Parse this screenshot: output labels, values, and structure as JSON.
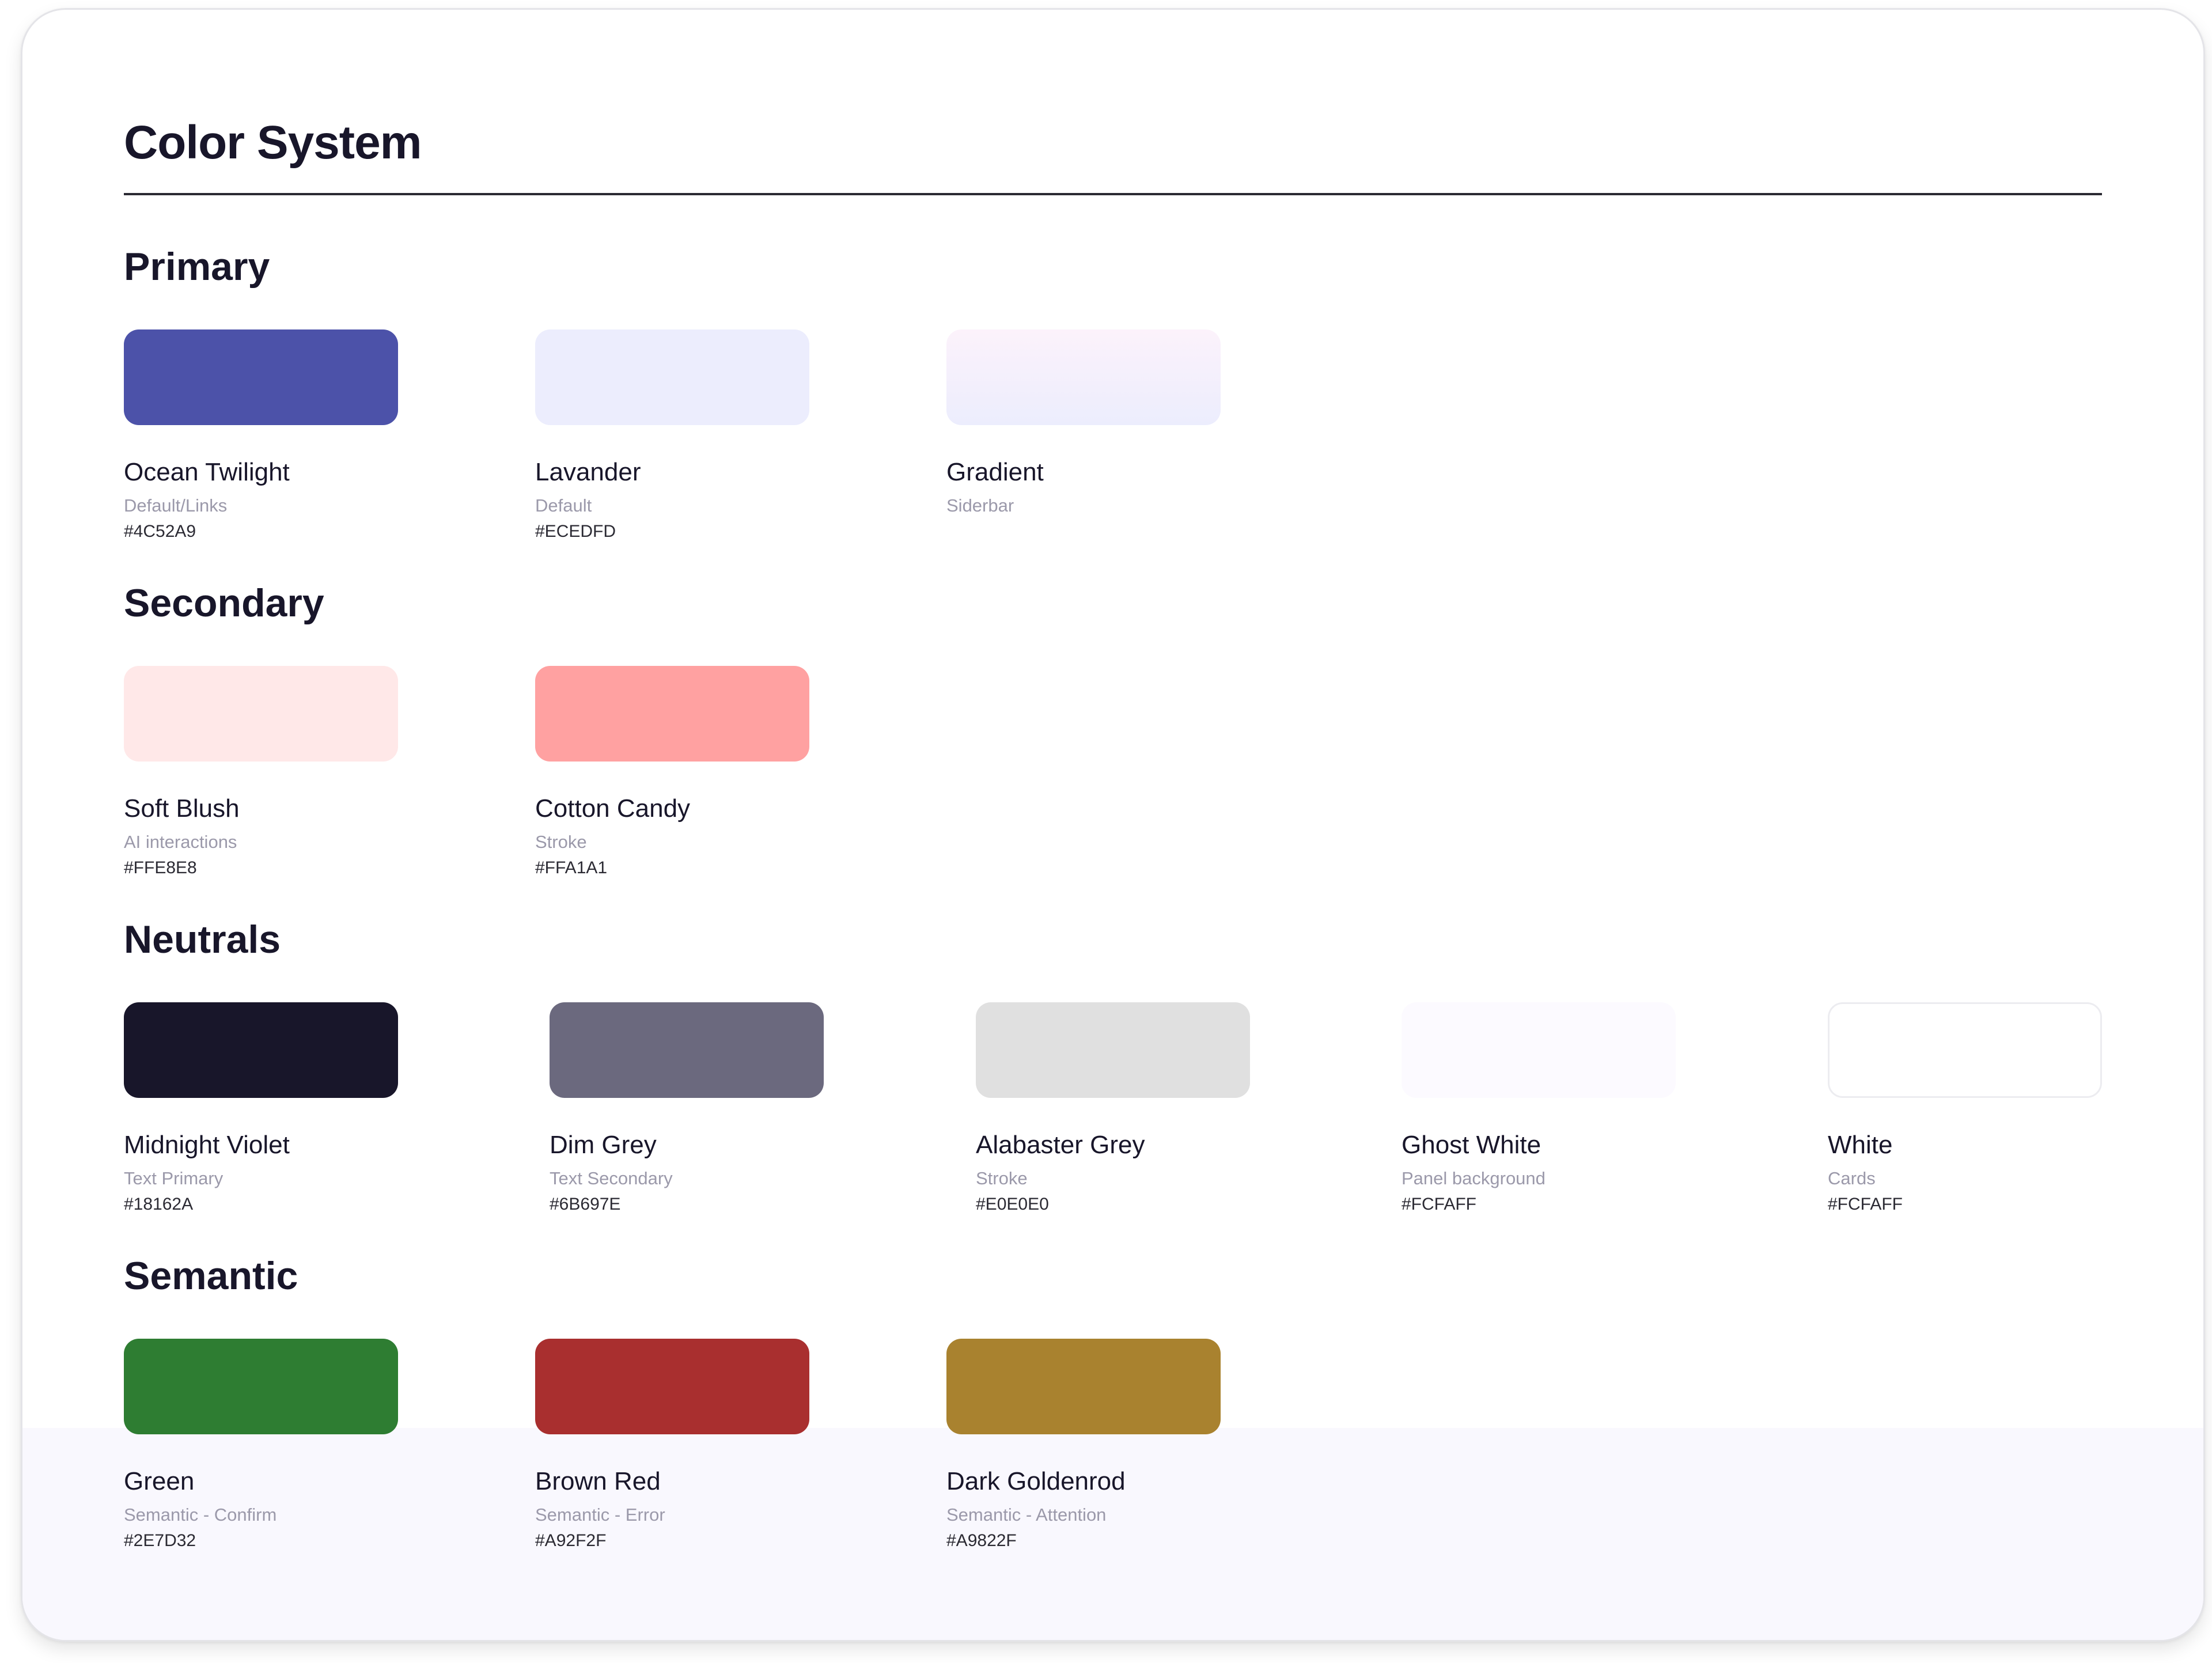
{
  "page": {
    "title": "Color System"
  },
  "sections": {
    "primary": {
      "title": "Primary",
      "swatches": [
        {
          "name": "Ocean Twilight",
          "usage": "Default/Links",
          "hex": "#4C52A9",
          "color": "#4C52A9"
        },
        {
          "name": "Lavander",
          "usage": "Default",
          "hex": "#ECEDFD",
          "color": "#ECEDFD"
        },
        {
          "name": "Gradient",
          "usage": "Siderbar",
          "gradient_from": "#FCF2FB",
          "gradient_to": "#ECEDFD"
        }
      ]
    },
    "secondary": {
      "title": "Secondary",
      "swatches": [
        {
          "name": "Soft Blush",
          "usage": "AI interactions",
          "hex": "#FFE8E8",
          "color": "#FFE8E8"
        },
        {
          "name": "Cotton Candy",
          "usage": "Stroke",
          "hex": "#FFA1A1",
          "color": "#FFA1A1"
        }
      ]
    },
    "neutrals": {
      "title": "Neutrals",
      "swatches": [
        {
          "name": "Midnight Violet",
          "usage": "Text Primary",
          "hex": "#18162A",
          "color": "#18162A"
        },
        {
          "name": "Dim Grey",
          "usage": "Text Secondary",
          "hex": "#6B697E",
          "color": "#6B697E"
        },
        {
          "name": "Alabaster Grey",
          "usage": "Stroke",
          "hex": "#E0E0E0",
          "color": "#E0E0E0"
        },
        {
          "name": "Ghost White",
          "usage": "Panel background",
          "hex": "#FCFAFF",
          "color": "#FCFAFF"
        },
        {
          "name": "White",
          "usage": "Cards",
          "hex": "#FCFAFF",
          "color": "#FFFFFF",
          "outlined": true
        }
      ]
    },
    "semantic": {
      "title": "Semantic",
      "swatches": [
        {
          "name": "Green",
          "usage": "Semantic - Confirm",
          "hex": "#2E7D32",
          "color": "#2E7D32"
        },
        {
          "name": "Brown Red",
          "usage": "Semantic - Error",
          "hex": "#A92F2F",
          "color": "#A92F2F"
        },
        {
          "name": "Dark Goldenrod",
          "usage": "Semantic - Attention",
          "hex": "#A9822F",
          "color": "#A9822F"
        }
      ]
    }
  }
}
